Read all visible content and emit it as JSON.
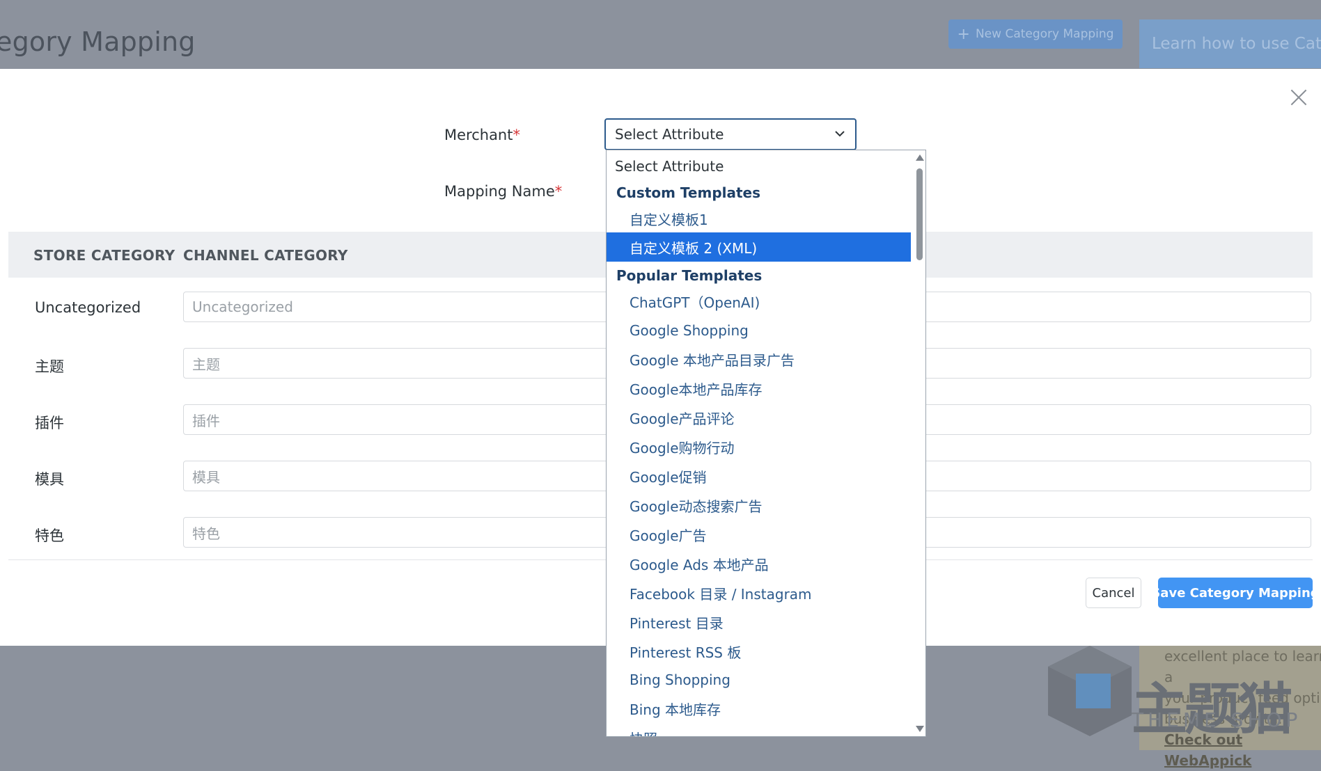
{
  "background": {
    "page_title": "egory Mapping",
    "new_button_label": "New Category Mapping",
    "learn_button_label": "Learn how to use Cate",
    "promo_lines": [
      "excellent place to learn a",
      "your product feed optin",
      "business growth."
    ],
    "promo_link": "Check out WebAppick",
    "watermark_text": "主题猫",
    "watermark_sub": "THEME SHOP"
  },
  "modal": {
    "merchant_label": "Merchant",
    "mapping_name_label": "Mapping Name",
    "required_mark": "*",
    "merchant_select_value": "Select Attribute",
    "table": {
      "col_store": "STORE CATEGORY",
      "col_channel": "CHANNEL CATEGORY",
      "rows": [
        {
          "store": "Uncategorized",
          "placeholder": "Uncategorized"
        },
        {
          "store": "主题",
          "placeholder": "主题"
        },
        {
          "store": "插件",
          "placeholder": "插件"
        },
        {
          "store": "模具",
          "placeholder": "模具"
        },
        {
          "store": "特色",
          "placeholder": "特色"
        }
      ]
    },
    "cancel_label": "Cancel",
    "save_label": "Save Category Mapping"
  },
  "dropdown": {
    "first_option": "Select Attribute",
    "groups": [
      {
        "label": "Custom Templates",
        "options": [
          "自定义模板1",
          "自定义模板 2 (XML)"
        ]
      },
      {
        "label": "Popular Templates",
        "options": [
          "ChatGPT（OpenAI)",
          "Google Shopping",
          "Google 本地产品目录广告",
          "Google本地产品库存",
          "Google产品评论",
          "Google购物行动",
          "Google促销",
          "Google动态搜索广告",
          "Google广告",
          "Google Ads 本地产品",
          "Facebook 目录 / Instagram",
          "Pinterest 目录",
          "Pinterest RSS 板",
          "Bing Shopping",
          "Bing 本地库存",
          "快照"
        ]
      }
    ],
    "selected_option": "自定义模板 2 (XML)"
  },
  "colors": {
    "accent": "#4295f3",
    "selected_bg": "#1f6fe0",
    "required": "#d63638"
  }
}
